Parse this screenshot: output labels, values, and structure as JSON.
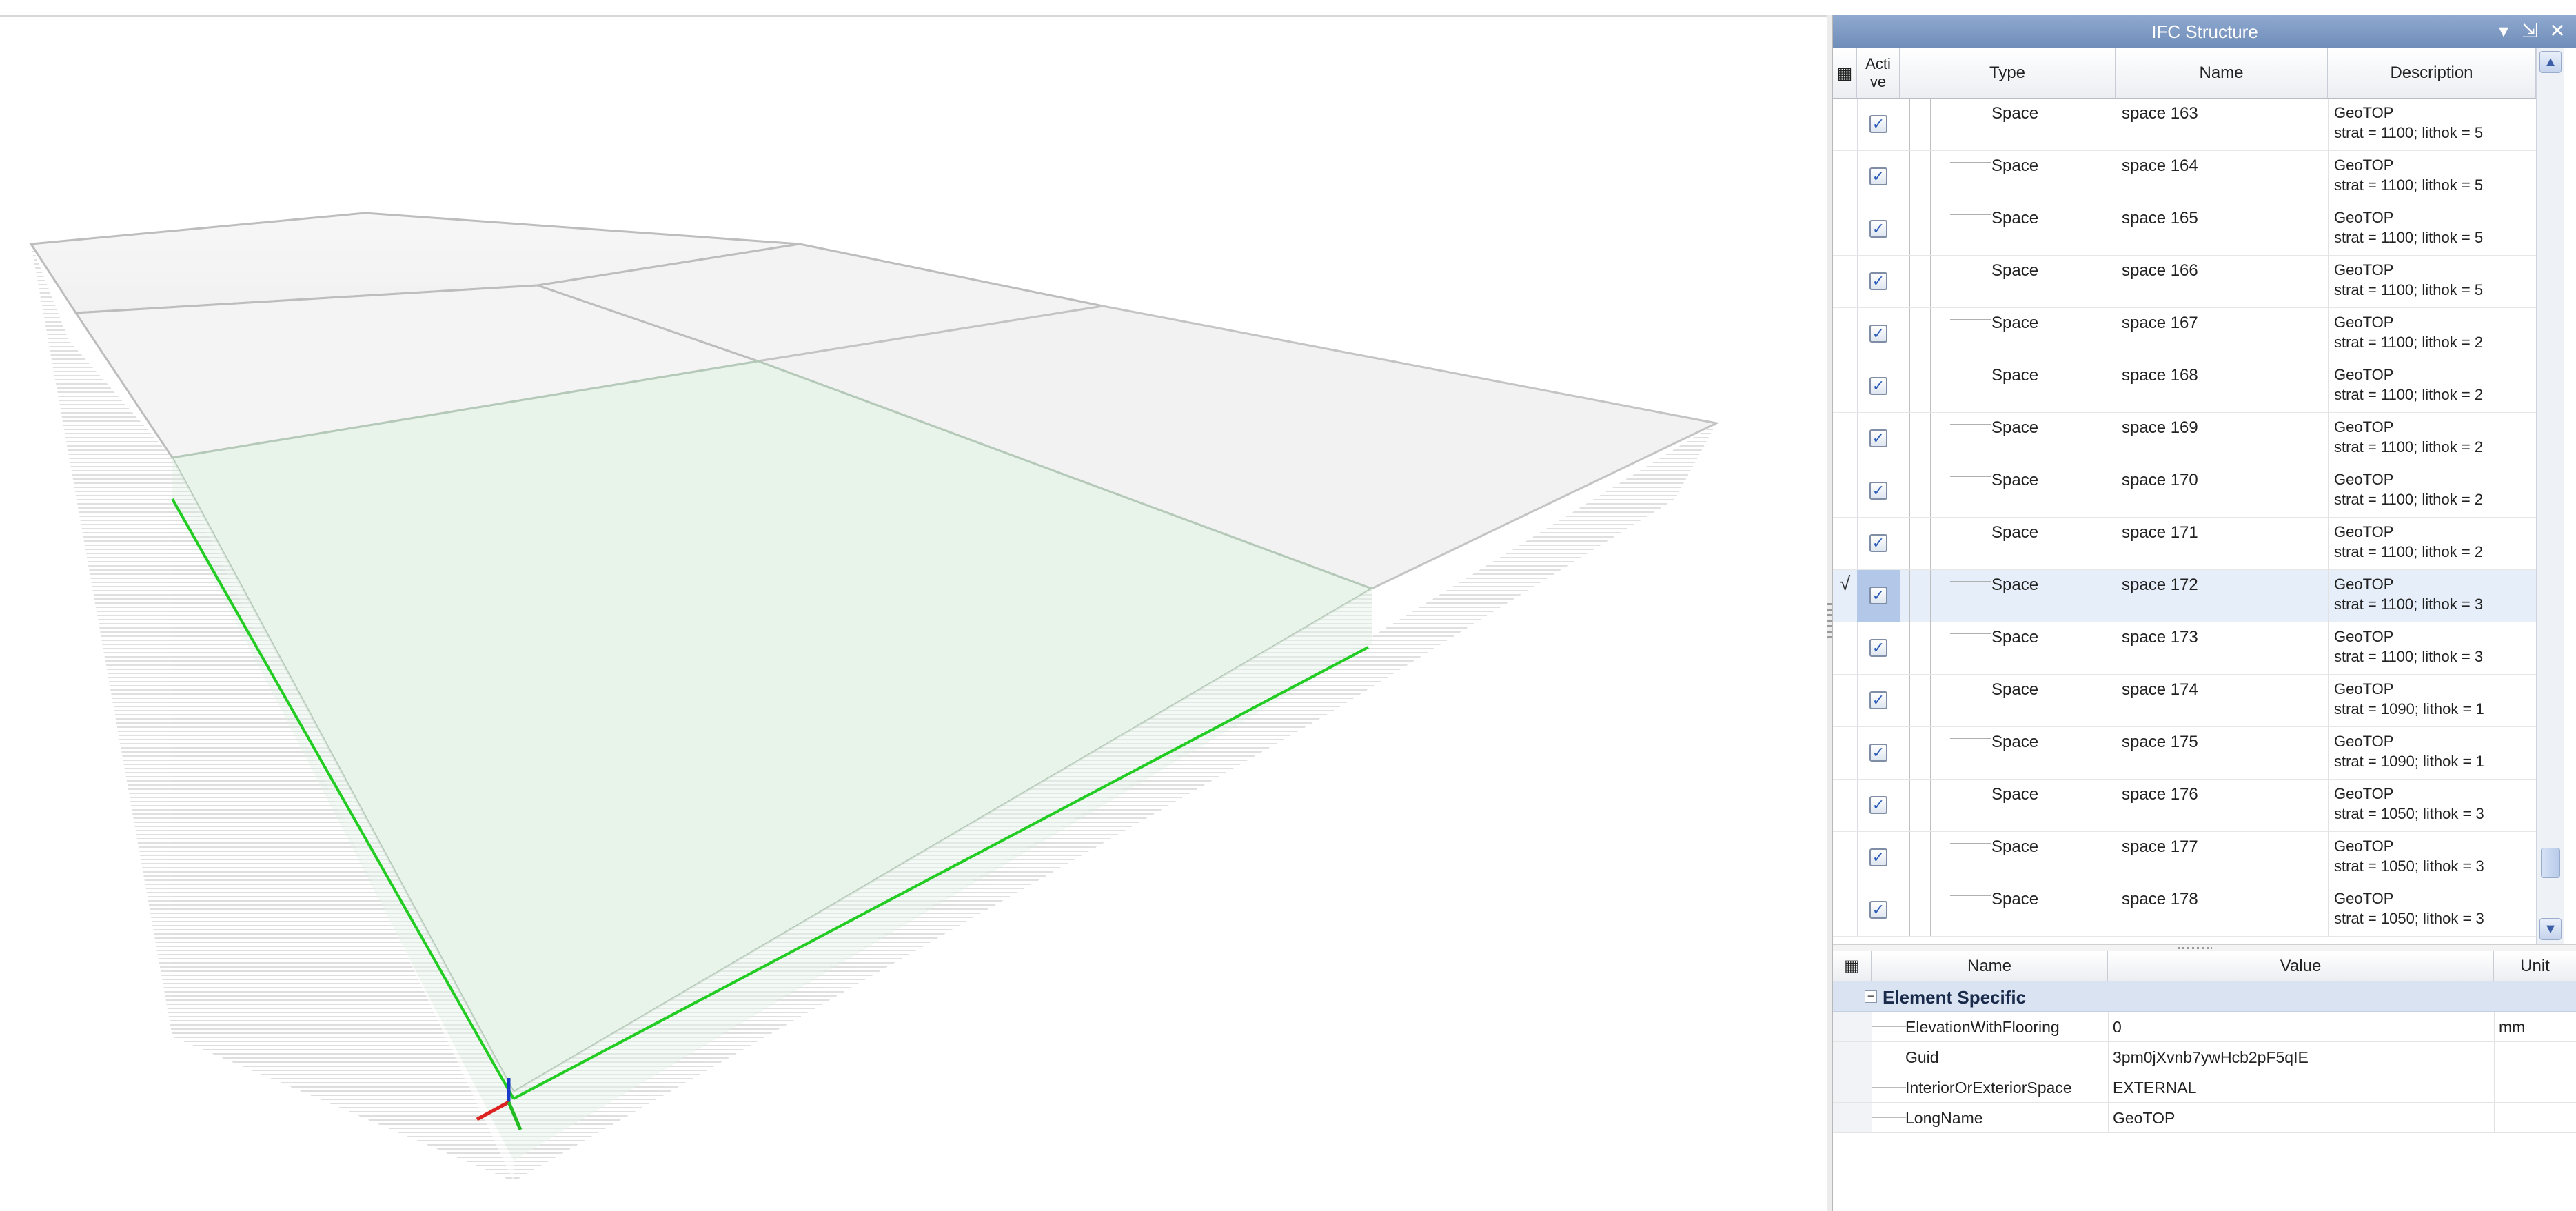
{
  "panel": {
    "title": "IFC Structure",
    "pin_icon": "pin-icon",
    "dropdown_icon": "dropdown-icon",
    "close_icon": "close-icon"
  },
  "structure_table": {
    "columns": {
      "active": "Acti ve",
      "type": "Type",
      "name": "Name",
      "description": "Description"
    },
    "rows": [
      {
        "active": true,
        "type": "Space",
        "name": "space 163",
        "desc1": "GeoTOP",
        "desc2": "strat = 1100; lithok = 5"
      },
      {
        "active": true,
        "type": "Space",
        "name": "space 164",
        "desc1": "GeoTOP",
        "desc2": "strat = 1100; lithok = 5"
      },
      {
        "active": true,
        "type": "Space",
        "name": "space 165",
        "desc1": "GeoTOP",
        "desc2": "strat = 1100; lithok = 5"
      },
      {
        "active": true,
        "type": "Space",
        "name": "space 166",
        "desc1": "GeoTOP",
        "desc2": "strat = 1100; lithok = 5"
      },
      {
        "active": true,
        "type": "Space",
        "name": "space 167",
        "desc1": "GeoTOP",
        "desc2": "strat = 1100; lithok = 2"
      },
      {
        "active": true,
        "type": "Space",
        "name": "space 168",
        "desc1": "GeoTOP",
        "desc2": "strat = 1100; lithok = 2"
      },
      {
        "active": true,
        "type": "Space",
        "name": "space 169",
        "desc1": "GeoTOP",
        "desc2": "strat = 1100; lithok = 2"
      },
      {
        "active": true,
        "type": "Space",
        "name": "space 170",
        "desc1": "GeoTOP",
        "desc2": "strat = 1100; lithok = 2"
      },
      {
        "active": true,
        "type": "Space",
        "name": "space 171",
        "desc1": "GeoTOP",
        "desc2": "strat = 1100; lithok = 2"
      },
      {
        "active": true,
        "type": "Space",
        "name": "space 172",
        "desc1": "GeoTOP",
        "desc2": "strat = 1100; lithok = 3",
        "selected": true,
        "indicator": "√"
      },
      {
        "active": true,
        "type": "Space",
        "name": "space 173",
        "desc1": "GeoTOP",
        "desc2": "strat = 1100; lithok = 3"
      },
      {
        "active": true,
        "type": "Space",
        "name": "space 174",
        "desc1": "GeoTOP",
        "desc2": "strat = 1090; lithok = 1"
      },
      {
        "active": true,
        "type": "Space",
        "name": "space 175",
        "desc1": "GeoTOP",
        "desc2": "strat = 1090; lithok = 1"
      },
      {
        "active": true,
        "type": "Space",
        "name": "space 176",
        "desc1": "GeoTOP",
        "desc2": "strat = 1050; lithok = 3"
      },
      {
        "active": true,
        "type": "Space",
        "name": "space 177",
        "desc1": "GeoTOP",
        "desc2": "strat = 1050; lithok = 3"
      },
      {
        "active": true,
        "type": "Space",
        "name": "space 178",
        "desc1": "GeoTOP",
        "desc2": "strat = 1050; lithok = 3"
      }
    ]
  },
  "properties": {
    "columns": {
      "name": "Name",
      "value": "Value",
      "unit": "Unit"
    },
    "category": "Element Specific",
    "rows": [
      {
        "name": "ElevationWithFlooring",
        "value": "0",
        "unit": "mm"
      },
      {
        "name": "Guid",
        "value": "3pm0jXvnb7ywHcb2pF5qIE",
        "unit": ""
      },
      {
        "name": "InteriorOrExteriorSpace",
        "value": "EXTERNAL",
        "unit": ""
      },
      {
        "name": "LongName",
        "value": "GeoTOP",
        "unit": ""
      }
    ]
  },
  "colors": {
    "title_bar": "#7f9bc6",
    "selection": "#e6eef9",
    "highlight_edge": "#22cc22"
  }
}
